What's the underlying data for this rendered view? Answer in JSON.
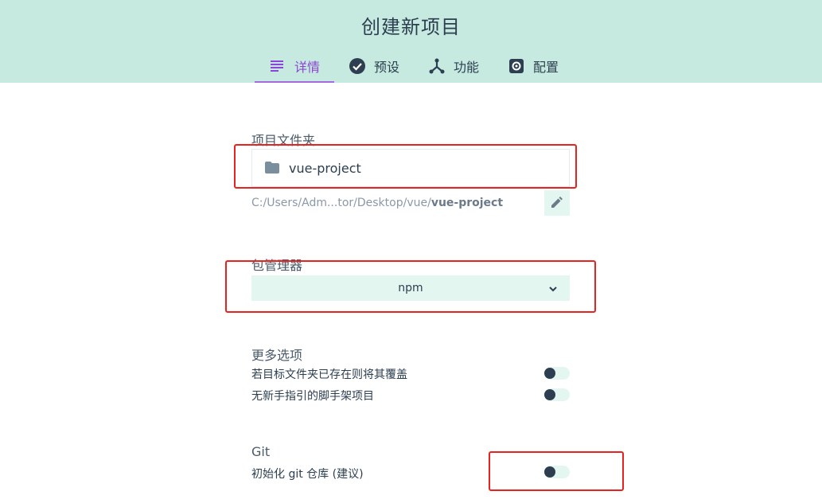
{
  "header": {
    "title": "创建新项目",
    "tabs": [
      {
        "label": "详情",
        "icon": "list-icon",
        "active": true
      },
      {
        "label": "预设",
        "icon": "check-circle-icon",
        "active": false
      },
      {
        "label": "功能",
        "icon": "fork-icon",
        "active": false
      },
      {
        "label": "配置",
        "icon": "gear-icon",
        "active": false
      }
    ]
  },
  "project_folder": {
    "label": "项目文件夹",
    "value": "vue-project",
    "path_prefix": "C:/Users/Adm...tor/Desktop/vue/",
    "path_name": "vue-project"
  },
  "package_manager": {
    "label": "包管理器",
    "selected": "npm"
  },
  "more_options": {
    "label": "更多选项",
    "items": [
      {
        "label": "若目标文件夹已存在则将其覆盖",
        "enabled": false
      },
      {
        "label": "无新手指引的脚手架项目",
        "enabled": false
      }
    ]
  },
  "git": {
    "label": "Git",
    "init_label": "初始化 git 仓库 (建议)",
    "enabled": false
  },
  "colors": {
    "header_bg": "#c6eadf",
    "active_tab": "#8e44d6",
    "field_bg": "#e3f6ef",
    "annotation": "#e8231f"
  }
}
